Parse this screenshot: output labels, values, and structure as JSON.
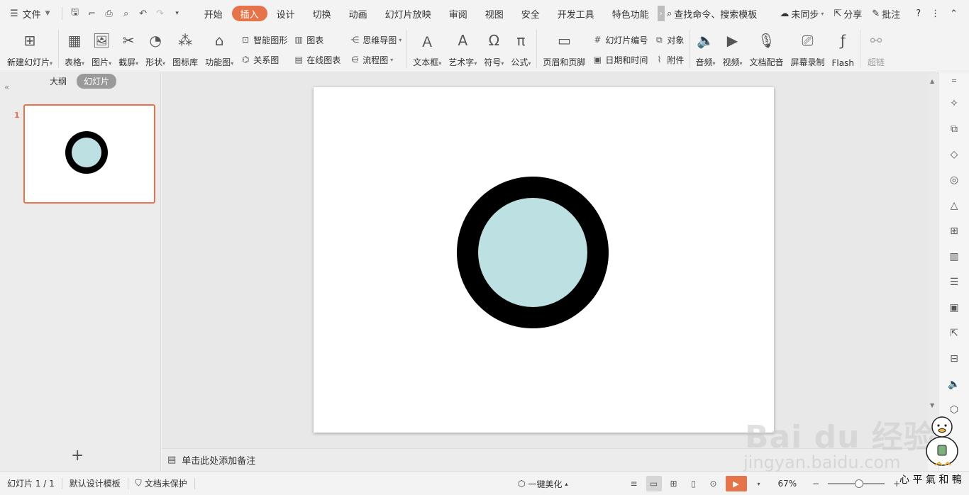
{
  "menubar": {
    "file_label": "文件",
    "tabs": [
      {
        "label": "开始",
        "active": false
      },
      {
        "label": "插入",
        "active": true
      },
      {
        "label": "设计",
        "active": false
      },
      {
        "label": "切换",
        "active": false
      },
      {
        "label": "动画",
        "active": false
      },
      {
        "label": "幻灯片放映",
        "active": false
      },
      {
        "label": "审阅",
        "active": false
      },
      {
        "label": "视图",
        "active": false
      },
      {
        "label": "安全",
        "active": false
      },
      {
        "label": "开发工具",
        "active": false
      },
      {
        "label": "特色功能",
        "active": false
      }
    ],
    "search_label": "查找命令、搜索模板",
    "sync_label": "未同步",
    "share_label": "分享",
    "comment_label": "批注"
  },
  "ribbon": {
    "new_slide": "新建幻灯片",
    "table": "表格",
    "picture": "图片",
    "screenshot": "截屏",
    "shape": "形状",
    "icon_lib": "图标库",
    "func_chart": "功能图",
    "smart_art": "智能图形",
    "chart": "图表",
    "relation": "关系图",
    "online_chart": "在线图表",
    "mindmap": "思维导图",
    "flowchart": "流程图",
    "textbox": "文本框",
    "wordart": "艺术字",
    "symbol": "符号",
    "formula": "公式",
    "header_footer": "页眉和页脚",
    "slide_number": "幻灯片编号",
    "object": "对象",
    "datetime": "日期和时间",
    "attachment": "附件",
    "audio": "音频",
    "video": "视频",
    "doc_voice": "文档配音",
    "screen_record": "屏幕录制",
    "flash": "Flash",
    "hyperlink": "超链"
  },
  "leftpanel": {
    "outline_tab": "大纲",
    "slides_tab": "幻灯片",
    "slide_number": "1"
  },
  "notes": {
    "placeholder": "单击此处添加备注"
  },
  "statusbar": {
    "slide_position": "幻灯片 1 / 1",
    "template": "默认设计模板",
    "protection": "文档未保护",
    "beautify": "一键美化",
    "zoom": "67%"
  },
  "watermark": {
    "brand": "Bai du 经验",
    "url": "jingyan.baidu.com",
    "signature": "心 平 氣 和 鴨"
  },
  "colors": {
    "accent": "#e5744a",
    "ring": "#000000",
    "fill": "#bde0e3"
  }
}
